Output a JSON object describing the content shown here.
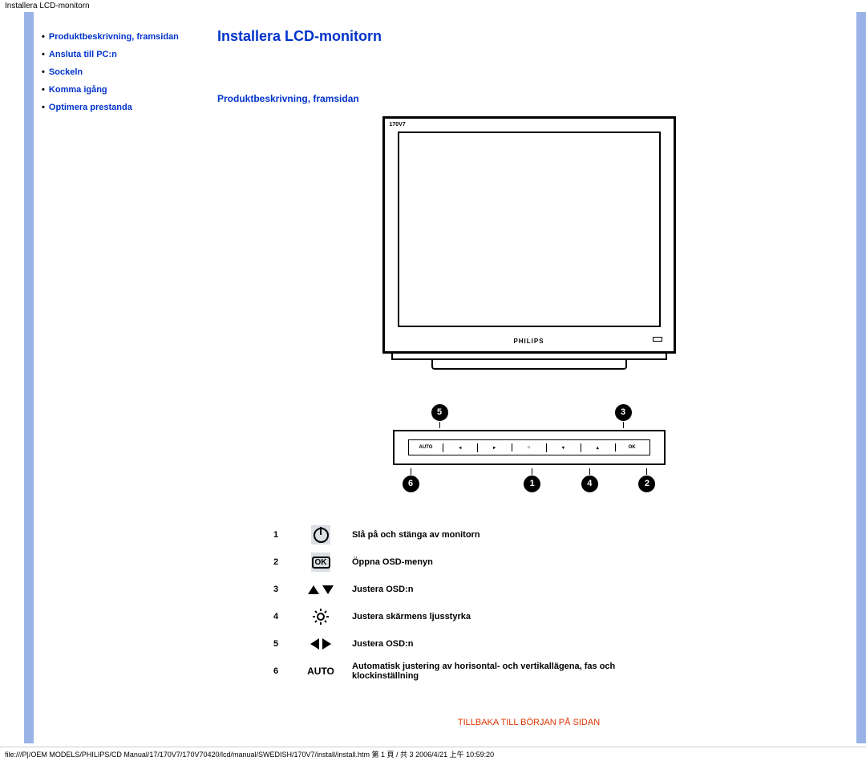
{
  "meta": {
    "header_path": "Installera LCD-monitorn",
    "footer_path": "file:///P|/OEM MODELS/PHILIPS/CD Manual/17/170V7/170V70420/lcd/manual/SWEDISH/170V7/install/install.htm 第 1 頁 / 共 3 2006/4/21 上午 10:59:20"
  },
  "sidebar": {
    "items": [
      {
        "label": "Produktbeskrivning, framsidan"
      },
      {
        "label": "Ansluta till PC:n"
      },
      {
        "label": "Sockeln"
      },
      {
        "label": "Komma igång"
      },
      {
        "label": "Optimera prestanda"
      }
    ]
  },
  "content": {
    "title": "Installera LCD-monitorn",
    "section_heading": "Produktbeskrivning, framsidan",
    "monitor": {
      "model": "170V7",
      "brand": "PHILIPS"
    },
    "panel": {
      "labels": [
        "AUTO",
        "◂",
        "▸",
        "☼",
        "▾",
        "▴",
        "OK"
      ]
    },
    "callouts_top": [
      "5",
      "3"
    ],
    "callouts_bottom": [
      "6",
      "1",
      "4",
      "2"
    ],
    "items": [
      {
        "num": "1",
        "icon": "power",
        "text": "Slå på och stänga av monitorn"
      },
      {
        "num": "2",
        "icon": "ok",
        "text": "Öppna OSD-menyn"
      },
      {
        "num": "3",
        "icon": "updown",
        "text": "Justera OSD:n"
      },
      {
        "num": "4",
        "icon": "bright",
        "text": "Justera skärmens ljusstyrka"
      },
      {
        "num": "5",
        "icon": "leftright",
        "text": "Justera OSD:n"
      },
      {
        "num": "6",
        "icon": "auto",
        "text": "Automatisk justering av horisontal- och vertikallägena, fas och klockinställning"
      }
    ],
    "back_link": "TILLBAKA TILL BÖRJAN PÅ SIDAN"
  }
}
